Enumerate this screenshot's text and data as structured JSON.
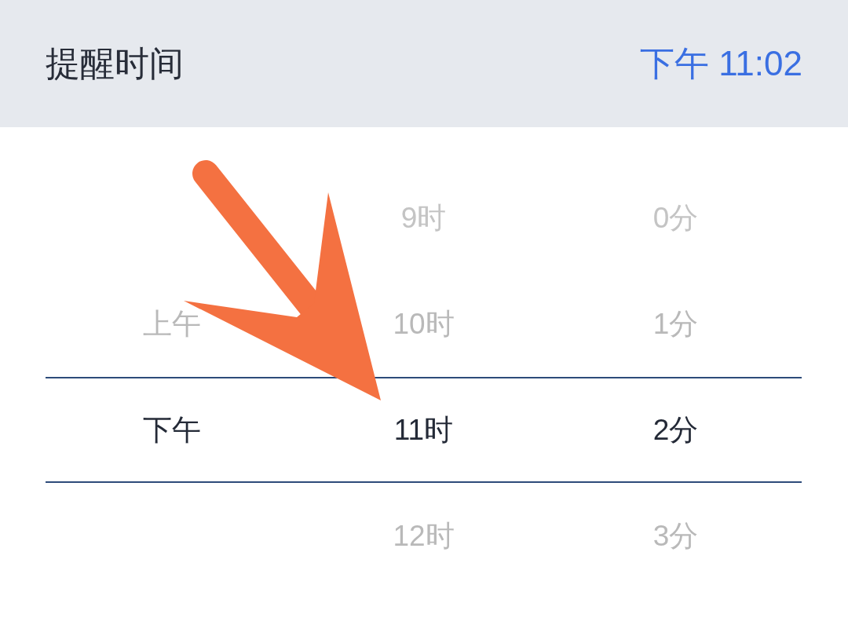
{
  "header": {
    "title": "提醒时间",
    "value": "下午 11:02"
  },
  "picker": {
    "columns": [
      {
        "items": [
          {
            "label": "上午",
            "selected": false
          },
          {
            "label": "下午",
            "selected": true
          }
        ]
      },
      {
        "items": [
          {
            "label": "9时",
            "selected": false
          },
          {
            "label": "10时",
            "selected": false
          },
          {
            "label": "11时",
            "selected": true
          },
          {
            "label": "12时",
            "selected": false
          }
        ]
      },
      {
        "items": [
          {
            "label": "0分",
            "selected": false
          },
          {
            "label": "1分",
            "selected": false
          },
          {
            "label": "2分",
            "selected": true
          },
          {
            "label": "3分",
            "selected": false
          }
        ]
      }
    ]
  }
}
